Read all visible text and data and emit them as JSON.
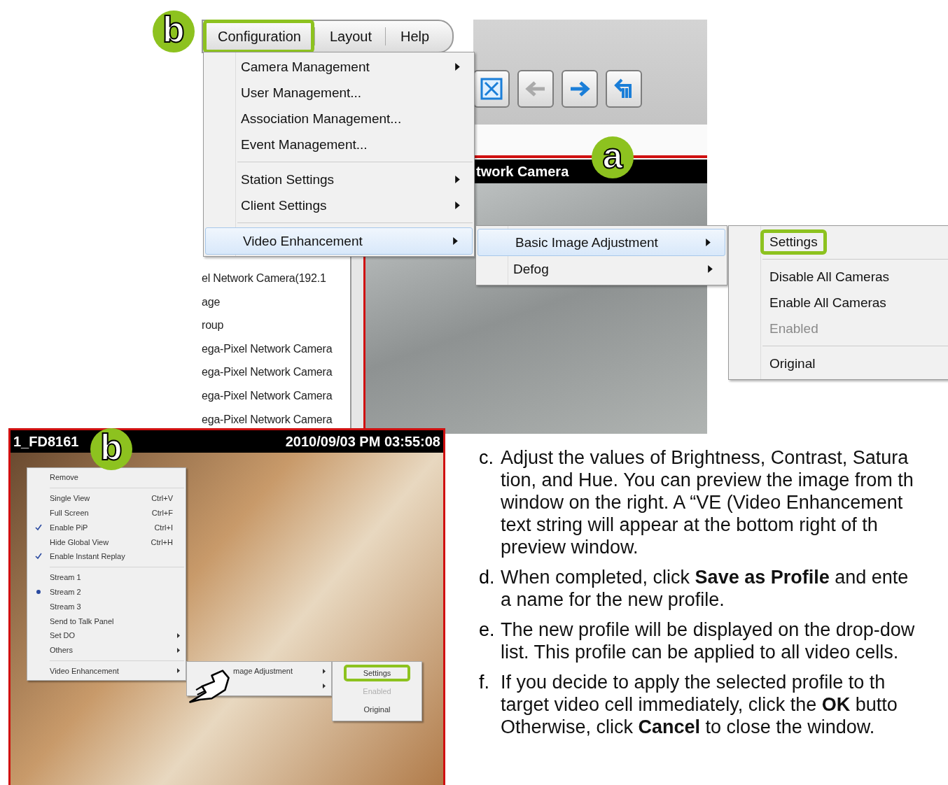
{
  "top_screenshot": {
    "callout_b": "b",
    "callout_a": "a",
    "menubar": [
      {
        "label": "Configuration",
        "outlined": true
      },
      {
        "label": "Layout",
        "outlined": false
      },
      {
        "label": "Help",
        "outlined": false
      }
    ],
    "configuration_menu": [
      [
        {
          "label": "Camera Management",
          "submenu": true,
          "selected": false
        },
        {
          "label": "User Management...",
          "submenu": false,
          "selected": false
        },
        {
          "label": "Association Management...",
          "submenu": false,
          "selected": false
        },
        {
          "label": "Event Management...",
          "submenu": false,
          "selected": false
        }
      ],
      [
        {
          "label": "Station Settings",
          "submenu": true,
          "selected": false
        },
        {
          "label": "Client Settings",
          "submenu": true,
          "selected": false
        }
      ],
      [
        {
          "label": "Video Enhancement",
          "submenu": true,
          "selected": true
        }
      ]
    ],
    "camera_list": [
      "el Network Camera(192.1",
      "age",
      "roup",
      "ega-Pixel Network Camera",
      "ega-Pixel Network Camera",
      "ega-Pixel Network Camera",
      "ega-Pixel Network Camera"
    ],
    "video_title": "twork Camera",
    "submenu": [
      {
        "label": "Basic Image Adjustment",
        "submenu": true,
        "selected": true
      },
      {
        "label": "Defog",
        "submenu": true,
        "selected": false
      }
    ],
    "settings_menu": [
      [
        {
          "label": "Settings",
          "disabled": false,
          "outlined": true
        }
      ],
      [
        {
          "label": "Disable All Cameras",
          "disabled": false,
          "outlined": false
        },
        {
          "label": "Enable All Cameras",
          "disabled": false,
          "outlined": false
        },
        {
          "label": "Enabled",
          "disabled": true,
          "outlined": false
        }
      ],
      [
        {
          "label": "Original",
          "disabled": false,
          "outlined": false
        }
      ]
    ]
  },
  "bottom_screenshot": {
    "callout_b": "b",
    "camera_name": "1_FD8161",
    "timestamp": "2010/09/03 PM 03:55:08",
    "context_menu": [
      [
        {
          "label": "Remove",
          "kind": "check",
          "checked": false,
          "submenu": false
        }
      ],
      [
        {
          "label": "Single View",
          "shortcut": "Ctrl+V",
          "kind": "check",
          "checked": false,
          "submenu": false
        },
        {
          "label": "Full Screen",
          "shortcut": "Ctrl+F",
          "kind": "check",
          "checked": false,
          "submenu": false
        },
        {
          "label": "Enable PiP",
          "shortcut": "Ctrl+I",
          "kind": "check",
          "checked": true,
          "submenu": false
        },
        {
          "label": "Hide Global View",
          "shortcut": "Ctrl+H",
          "kind": "check",
          "checked": false,
          "submenu": false
        },
        {
          "label": "Enable Instant Replay",
          "kind": "check",
          "checked": true,
          "submenu": false
        }
      ],
      [
        {
          "label": "Stream 1",
          "kind": "radio",
          "checked": false,
          "submenu": false
        },
        {
          "label": "Stream 2",
          "kind": "radio",
          "checked": true,
          "submenu": false
        },
        {
          "label": "Stream 3",
          "kind": "radio",
          "checked": false,
          "submenu": false
        },
        {
          "label": "Send to Talk Panel",
          "kind": "check",
          "checked": false,
          "submenu": false
        },
        {
          "label": "Set DO",
          "kind": "check",
          "checked": false,
          "submenu": true
        },
        {
          "label": "Others",
          "kind": "check",
          "checked": false,
          "submenu": true
        }
      ],
      [
        {
          "label": "Video Enhancement",
          "kind": "check",
          "checked": false,
          "submenu": true
        }
      ]
    ],
    "submenu": [
      {
        "label": "mage Adjustment",
        "submenu": true
      },
      {
        "submenu": true
      }
    ],
    "settings_menu": [
      {
        "label": "Settings",
        "disabled": false,
        "outlined": true
      },
      {
        "label": "Enabled",
        "disabled": true,
        "outlined": false
      },
      {
        "label": "Original",
        "disabled": false,
        "outlined": false
      }
    ]
  },
  "instructions": [
    {
      "marker": "c.",
      "lines": [
        "Adjust the values of Brightness, Contrast, Satura",
        "tion, and Hue. You can preview the image from th",
        "window on the right. A “VE (Video Enhancement",
        "text string will appear at the bottom right of th",
        "preview window."
      ]
    },
    {
      "marker": "d.",
      "lines": [
        "When completed, click **Save as Profile** and ente",
        "a name for the new profile."
      ]
    },
    {
      "marker": "e.",
      "lines": [
        "The new profile will be displayed on the drop-dow",
        "list. This profile can be applied to all video cells."
      ]
    },
    {
      "marker": "f.",
      "lines": [
        "If you decide to apply the selected profile to th",
        "target video cell immediately, click the **OK** butto",
        "Otherwise, click **Cancel** to close the window."
      ]
    }
  ]
}
